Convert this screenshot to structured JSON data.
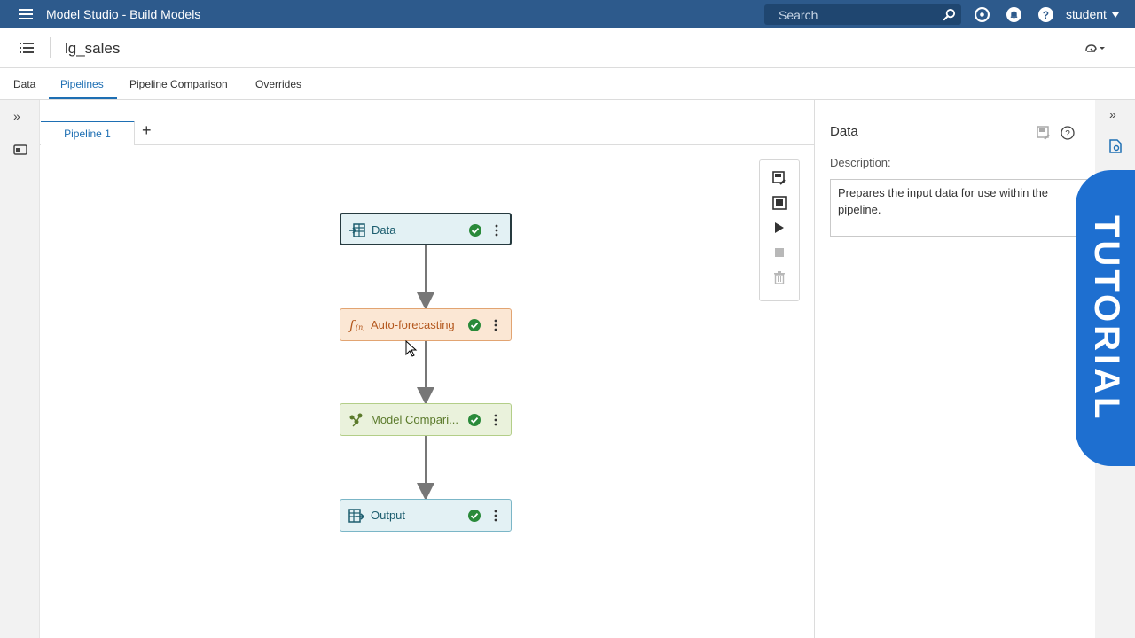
{
  "app": {
    "title": "Model Studio - Build Models",
    "search_placeholder": "Search",
    "user": "student"
  },
  "project": {
    "name": "lg_sales"
  },
  "tabs": [
    {
      "label": "Data",
      "active": false
    },
    {
      "label": "Pipelines",
      "active": true
    },
    {
      "label": "Pipeline Comparison",
      "active": false
    },
    {
      "label": "Overrides",
      "active": false
    }
  ],
  "pipeline_tabs": [
    {
      "label": "Pipeline 1",
      "active": true
    }
  ],
  "pipeline_add": "+",
  "nodes": [
    {
      "label": "Data",
      "icon": "data-source-icon",
      "status": "completed",
      "selected": true
    },
    {
      "label": "Auto-forecasting",
      "icon": "function-icon",
      "status": "completed",
      "selected": false
    },
    {
      "label": "Model Compari...",
      "icon": "model-comparison-icon",
      "status": "completed",
      "selected": false
    },
    {
      "label": "Output",
      "icon": "output-icon",
      "status": "completed",
      "selected": false
    }
  ],
  "properties": {
    "title": "Data",
    "description_label": "Description:",
    "description_value": "Prepares the input data for use within the pipeline."
  },
  "tutorial": {
    "label": "TUTORIAL"
  },
  "colors": {
    "header": "#2d5a8c",
    "accent": "#1e6fb3",
    "tutorial": "#1e6fd0",
    "status_ok": "#2a8a3a"
  }
}
